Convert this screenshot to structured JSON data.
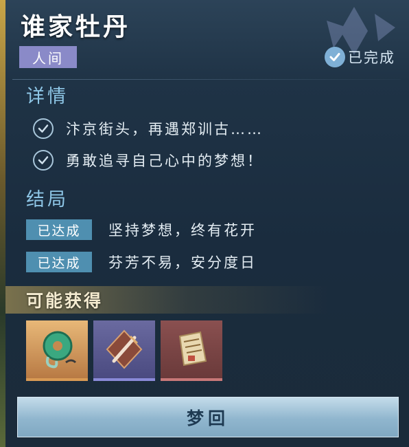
{
  "header": {
    "title": "谁家牡丹",
    "realm": "人间",
    "status": "已完成"
  },
  "details": {
    "heading": "详情",
    "items": [
      "汴京街头，再遇郑训古……",
      "勇敢追寻自己心中的梦想！"
    ]
  },
  "endings": {
    "heading": "结局",
    "items": [
      {
        "badge": "已达成",
        "text": "坚持梦想，终有花开"
      },
      {
        "badge": "已达成",
        "text": "芬芳不易，安分度日"
      }
    ]
  },
  "rewards": {
    "heading": "可能获得",
    "items": [
      {
        "icon": "jade-pendant-icon",
        "rarity": "gold"
      },
      {
        "icon": "dagger-icon",
        "rarity": "purple"
      },
      {
        "icon": "paper-scroll-icon",
        "rarity": "red"
      }
    ]
  },
  "actions": {
    "replay_label": "梦回"
  },
  "colors": {
    "accent": "#8ec6e6",
    "realm_tag": "#8a8ac8",
    "badge": "#4f8fb0",
    "button": "#a8c6da"
  }
}
